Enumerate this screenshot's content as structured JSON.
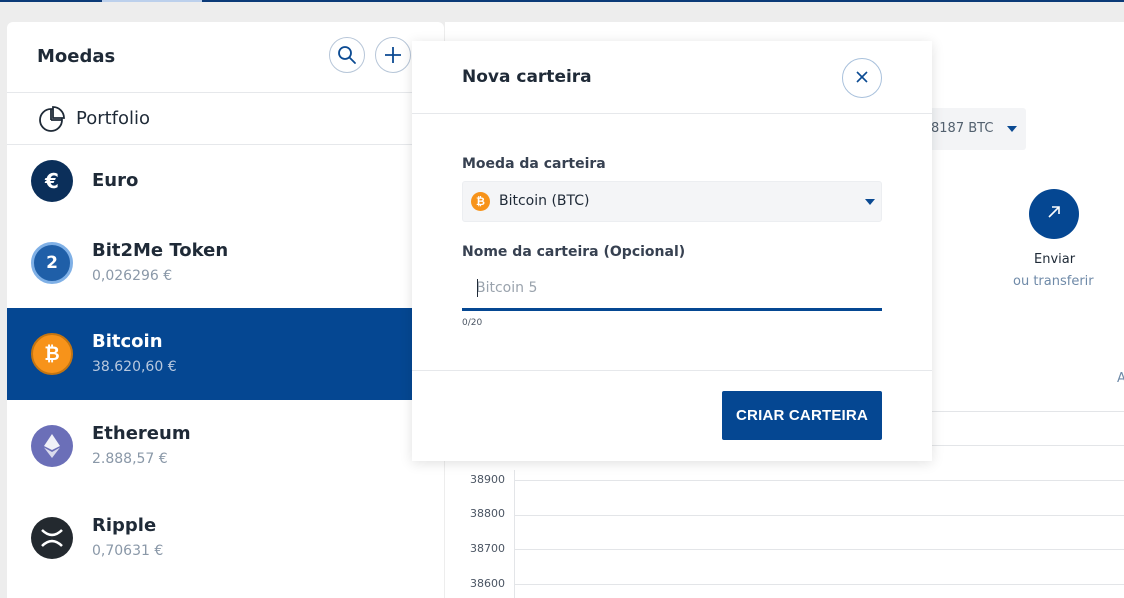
{
  "sidebar": {
    "title": "Moedas",
    "portfolio_label": "Portfolio",
    "coins": [
      {
        "name": "Euro",
        "value": ""
      },
      {
        "name": "Bit2Me Token",
        "value": "0,026296 €"
      },
      {
        "name": "Bitcoin",
        "value": "38.620,60 €"
      },
      {
        "name": "Ethereum",
        "value": "2.888,57 €"
      },
      {
        "name": "Ripple",
        "value": "0,70631 €"
      }
    ],
    "selected_coin": "Bitcoin"
  },
  "main": {
    "balance_select_value": "8187 BTC",
    "send_label": "Enviar",
    "send_sublabel": "ou transferir",
    "partial_header_letter": "A",
    "chart_yticks": [
      "38900",
      "38800",
      "38700",
      "38600"
    ]
  },
  "modal": {
    "title": "Nova carteira",
    "coin_field_label": "Moeda da carteira",
    "coin_field_value": "Bitcoin (BTC)",
    "name_field_label": "Nome da carteira (Opcional)",
    "name_field_placeholder": "Bitcoin 5",
    "name_field_value": "",
    "char_counter": "0/20",
    "create_button_label": "CRIAR CARTEIRA"
  },
  "colors": {
    "primary": "#054792",
    "bitcoin": "#f7931a",
    "ethereum": "#6b6fb8",
    "euro": "#0b2f5a",
    "ripple": "#23292f"
  },
  "icons": {
    "search": "search-icon",
    "add": "plus-icon",
    "portfolio": "pie-chart-icon",
    "close": "close-icon",
    "send": "arrow-up-right-icon"
  }
}
